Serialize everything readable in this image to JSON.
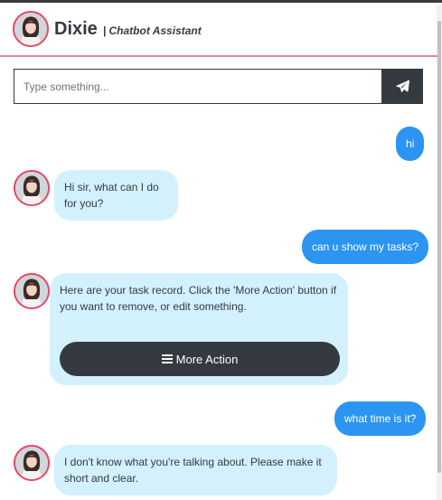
{
  "header": {
    "title": "Dixie",
    "subtitle": "| Chatbot Assistant"
  },
  "composer": {
    "placeholder": "Type something...",
    "value": ""
  },
  "icons": {
    "send": "paper-plane-icon",
    "menu": "bars-icon",
    "avatar": "dixie-avatar"
  },
  "colors": {
    "user_bubble": "#2b95f1",
    "bot_bubble": "#d3f1fd",
    "dark": "#343a40",
    "header_accent": "#e8859a",
    "avatar_ring": "#e8455e"
  },
  "messages": [
    {
      "from": "user",
      "text": "hi"
    },
    {
      "from": "bot",
      "text": "Hi sir, what can I do for you?"
    },
    {
      "from": "user",
      "text": "can u show my tasks?"
    },
    {
      "from": "bot",
      "text": "Here are your task record. Click the 'More Action' button if you want to remove, or edit something.",
      "button_label": "More Action"
    },
    {
      "from": "user",
      "text": "what time is it?"
    },
    {
      "from": "bot",
      "text": "I don't know what you're talking about. Please make it short and clear."
    }
  ]
}
